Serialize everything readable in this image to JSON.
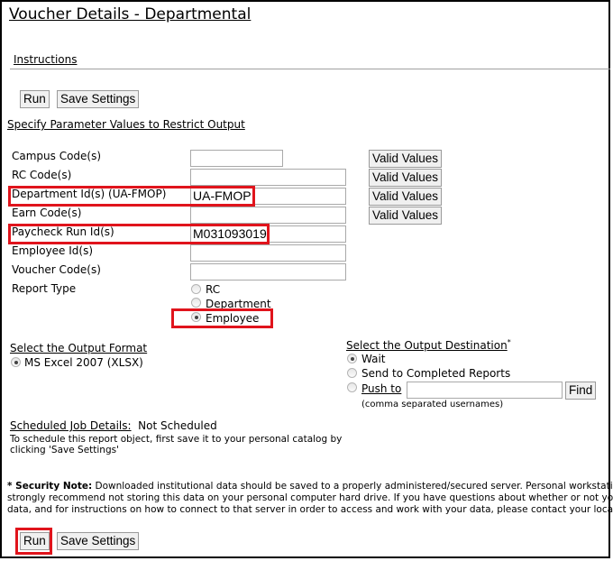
{
  "page": {
    "title": "Voucher Details - Departmental",
    "instructions_link": "Instructions"
  },
  "toolbar_top": {
    "run_label": "Run",
    "save_label": "Save Settings"
  },
  "parameters": {
    "heading": "Specify Parameter Values to Restrict Output",
    "valid_values_label": "Valid Values",
    "fields": [
      {
        "label": "Campus Code(s)",
        "value": ""
      },
      {
        "label": "RC Code(s)",
        "value": ""
      },
      {
        "label": "Department Id(s) (UA-FMOP)",
        "value": "UA-FMOP"
      },
      {
        "label": "Earn Code(s)",
        "value": ""
      },
      {
        "label": "Paycheck Run Id(s)",
        "value": "M031093019"
      },
      {
        "label": "Employee Id(s)",
        "value": ""
      },
      {
        "label": "Voucher Code(s)",
        "value": ""
      }
    ],
    "report_type": {
      "label": "Report Type",
      "options": [
        "RC",
        "Department",
        "Employee"
      ],
      "selected": "Employee"
    }
  },
  "output_format": {
    "heading": "Select the Output Format",
    "options": [
      "MS Excel 2007 (XLSX)"
    ],
    "selected": "MS Excel 2007 (XLSX)"
  },
  "output_destination": {
    "heading": "Select the Output Destination",
    "asterisk": "*",
    "options": [
      "Wait",
      "Send to Completed Reports"
    ],
    "push_to_label": "Push to",
    "push_to_value": "",
    "find_label": "Find",
    "hint": "(comma separated usernames)",
    "selected": "Wait"
  },
  "schedule": {
    "heading": "Scheduled Job Details:",
    "status": "Not Scheduled",
    "info_line1": "To schedule this report object, first save it to your personal catalog by",
    "info_line2": "clicking 'Save Settings'"
  },
  "security_note": {
    "label": "* Security Note:",
    "line1": " Downloaded institutional data should be saved to a properly administered/secured server. Personal workstations may not be",
    "line2": "strongly recommend not storing this data on your personal computer hard drive. If you have questions about whether or not your department",
    "line3": "data, and for instructions on how to connect to that server in order to access and work with your data, please contact your local computer support"
  },
  "toolbar_bottom": {
    "run_label": "Run",
    "save_label": "Save Settings"
  },
  "colors": {
    "highlight": "#e0141c"
  }
}
